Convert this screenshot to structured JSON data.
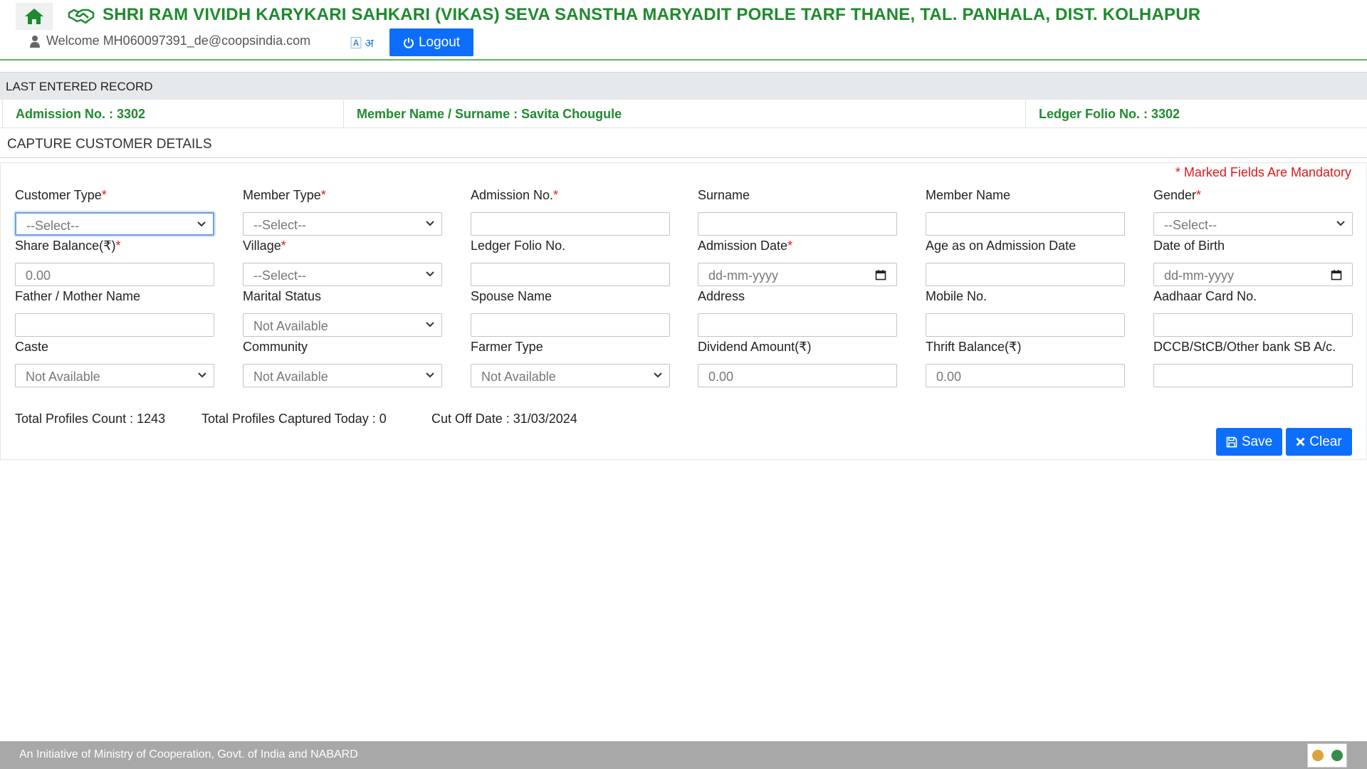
{
  "header": {
    "org_name": "SHRI RAM VIVIDH KARYKARI SAHKARI (VIKAS) SEVA SANSTHA MARYADIT PORLE TARF THANE, TAL. PANHALA, DIST. KOLHAPUR",
    "welcome": "Welcome MH060097391_de@coopsindia.com",
    "lang_toggle": "अ",
    "logout_label": "Logout",
    "icons": [
      "home-icon",
      "handshake-icon",
      "user-icon",
      "language-icon",
      "power-icon"
    ],
    "brand_color": "#1f8a2e",
    "accent_color": "#0d6efd"
  },
  "last_record": {
    "title": "LAST ENTERED RECORD",
    "admission": "Admission No. : 3302",
    "member": "Member Name / Surname : Savita Chougule",
    "ledger": "Ledger Folio No. : 3302"
  },
  "form": {
    "title": "CAPTURE CUSTOMER DETAILS",
    "mandatory_note": "* Marked Fields Are Mandatory",
    "fields": {
      "customer_type": {
        "label": "Customer Type",
        "required": "*",
        "value": "--Select--"
      },
      "member_type": {
        "label": "Member Type",
        "required": "*",
        "value": "--Select--"
      },
      "admission_no": {
        "label": "Admission No.",
        "required": "*",
        "value": ""
      },
      "surname": {
        "label": "Surname",
        "value": ""
      },
      "member_name": {
        "label": "Member Name",
        "value": ""
      },
      "gender": {
        "label": "Gender",
        "required": "*",
        "value": "--Select--"
      },
      "share_balance": {
        "label": "Share Balance(₹)",
        "required": "*",
        "placeholder": "0.00"
      },
      "village": {
        "label": "Village",
        "required": "*",
        "value": "--Select--"
      },
      "ledger_folio": {
        "label": "Ledger Folio No.",
        "value": ""
      },
      "admission_date": {
        "label": "Admission Date",
        "required": "*",
        "placeholder": "dd-mm-yyyy"
      },
      "age_on_admission": {
        "label": "Age as on Admission Date",
        "value": ""
      },
      "dob": {
        "label": "Date of Birth",
        "placeholder": "dd-mm-yyyy"
      },
      "parent_name": {
        "label": "Father / Mother Name",
        "value": ""
      },
      "marital_status": {
        "label": "Marital Status",
        "value": "Not Available"
      },
      "spouse_name": {
        "label": "Spouse Name",
        "value": ""
      },
      "address": {
        "label": "Address",
        "value": ""
      },
      "mobile": {
        "label": "Mobile No.",
        "value": ""
      },
      "aadhaar": {
        "label": "Aadhaar Card No.",
        "value": ""
      },
      "caste": {
        "label": "Caste",
        "value": "Not Available"
      },
      "community": {
        "label": "Community",
        "value": "Not Available"
      },
      "farmer_type": {
        "label": "Farmer Type",
        "value": "Not Available"
      },
      "dividend": {
        "label": "Dividend Amount(₹)",
        "placeholder": "0.00"
      },
      "thrift": {
        "label": "Thrift Balance(₹)",
        "placeholder": "0.00"
      },
      "bank_ac": {
        "label": "DCCB/StCB/Other bank SB A/c.",
        "value": ""
      }
    },
    "stats": {
      "total": "Total Profiles Count : 1243",
      "today": "Total Profiles Captured Today : 0",
      "cutoff": "Cut Off Date : 31/03/2024"
    },
    "save_label": "Save",
    "clear_label": "Clear"
  },
  "footer": {
    "text": "An Initiative of Ministry of Cooperation, Govt. of India and NABARD"
  }
}
